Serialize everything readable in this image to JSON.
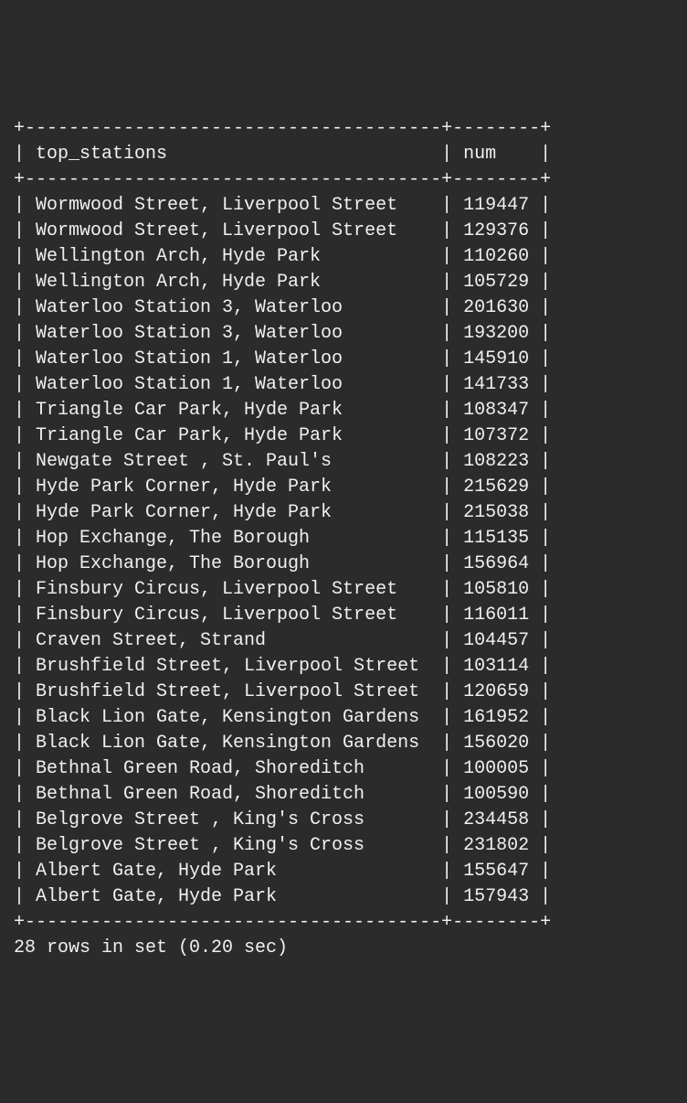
{
  "table": {
    "headers": [
      "top_stations",
      "num"
    ],
    "border_top": "+--------------------------------------+--------+",
    "rows": [
      {
        "station": "Wormwood Street, Liverpool Street",
        "num": "119447"
      },
      {
        "station": "Wormwood Street, Liverpool Street",
        "num": "129376"
      },
      {
        "station": "Wellington Arch, Hyde Park",
        "num": "110260"
      },
      {
        "station": "Wellington Arch, Hyde Park",
        "num": "105729"
      },
      {
        "station": "Waterloo Station 3, Waterloo",
        "num": "201630"
      },
      {
        "station": "Waterloo Station 3, Waterloo",
        "num": "193200"
      },
      {
        "station": "Waterloo Station 1, Waterloo",
        "num": "145910"
      },
      {
        "station": "Waterloo Station 1, Waterloo",
        "num": "141733"
      },
      {
        "station": "Triangle Car Park, Hyde Park",
        "num": "108347"
      },
      {
        "station": "Triangle Car Park, Hyde Park",
        "num": "107372"
      },
      {
        "station": "Newgate Street , St. Paul's",
        "num": "108223"
      },
      {
        "station": "Hyde Park Corner, Hyde Park",
        "num": "215629"
      },
      {
        "station": "Hyde Park Corner, Hyde Park",
        "num": "215038"
      },
      {
        "station": "Hop Exchange, The Borough",
        "num": "115135"
      },
      {
        "station": "Hop Exchange, The Borough",
        "num": "156964"
      },
      {
        "station": "Finsbury Circus, Liverpool Street",
        "num": "105810"
      },
      {
        "station": "Finsbury Circus, Liverpool Street",
        "num": "116011"
      },
      {
        "station": "Craven Street, Strand",
        "num": "104457"
      },
      {
        "station": "Brushfield Street, Liverpool Street",
        "num": "103114"
      },
      {
        "station": "Brushfield Street, Liverpool Street",
        "num": "120659"
      },
      {
        "station": "Black Lion Gate, Kensington Gardens",
        "num": "161952"
      },
      {
        "station": "Black Lion Gate, Kensington Gardens",
        "num": "156020"
      },
      {
        "station": "Bethnal Green Road, Shoreditch",
        "num": "100005"
      },
      {
        "station": "Bethnal Green Road, Shoreditch",
        "num": "100590"
      },
      {
        "station": "Belgrove Street , King's Cross",
        "num": "234458"
      },
      {
        "station": "Belgrove Street , King's Cross",
        "num": "231802"
      },
      {
        "station": "Albert Gate, Hyde Park",
        "num": "155647"
      },
      {
        "station": "Albert Gate, Hyde Park",
        "num": "157943"
      }
    ],
    "col1_width": 36,
    "col2_width": 6
  },
  "footer": "28 rows in set (0.20 sec)"
}
